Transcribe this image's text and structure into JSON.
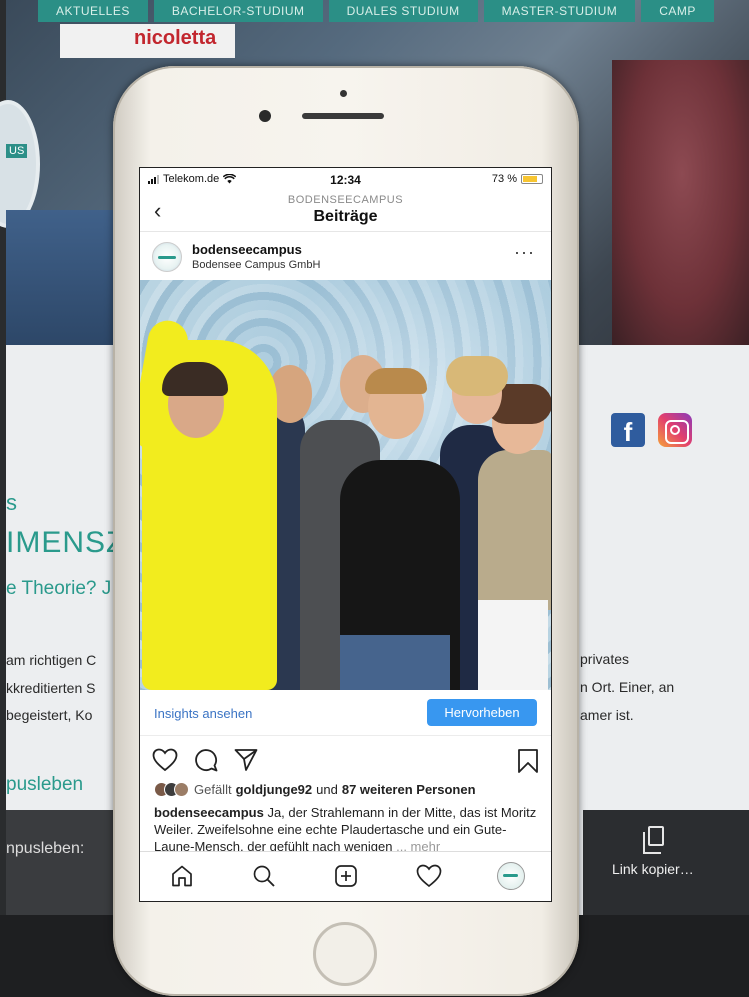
{
  "background": {
    "nav_tabs": [
      "AKTUELLES",
      "BACHELOR-STUDIUM",
      "DUALES STUDIUM",
      "MASTER-STUDIUM",
      "CAMP"
    ],
    "sign_text": "nicoletta",
    "logo_badge": "US",
    "headline_fragment": "IMENSZ",
    "sub_fragment": "e Theorie? J",
    "letter_s": "s",
    "lines_left": [
      "am richtigen C",
      "kkreditierten S",
      " begeistert, Ko"
    ],
    "lines_right": [
      "privates",
      "n Ort. Einer, an",
      "amer ist."
    ],
    "link_left": "pusleben",
    "dark_left": "npusleben: ",
    "copy_label": "Link kopier…"
  },
  "status_bar": {
    "carrier": "Telekom.de",
    "time": "12:34",
    "battery": "73 %"
  },
  "header": {
    "back_glyph": "‹",
    "subtitle": "BODENSEECAMPUS",
    "title": "Beiträge"
  },
  "post": {
    "username": "bodenseecampus",
    "location": "Bodensee Campus GmbH",
    "more_glyph": "···",
    "insights_link": "Insights ansehen",
    "promote_button": "Hervorheben",
    "likes_prefix": "Gefällt",
    "likes_user": "goldjunge92",
    "likes_middle": "und",
    "likes_rest": "87 weiteren Personen",
    "caption_user": "bodenseecampus",
    "caption_text": " Ja, der Strahlemann in der Mitte, das ist Moritz Weiler. Zweifelsohne eine echte Plaudertasche und ein Gute-Laune-Mensch, der gefühlt nach wenigen ",
    "caption_more": "... mehr"
  },
  "icons": {
    "like": "heart-icon",
    "comment": "comment-icon",
    "share": "send-icon",
    "save": "bookmark-icon",
    "home": "home-icon",
    "search": "search-icon",
    "add": "add-post-icon",
    "activity": "activity-heart-icon",
    "profile": "profile-avatar-icon"
  },
  "colors": {
    "accent_blue": "#3897f0",
    "link_blue": "#3b74c4",
    "brand_teal": "#2a9a8c"
  }
}
